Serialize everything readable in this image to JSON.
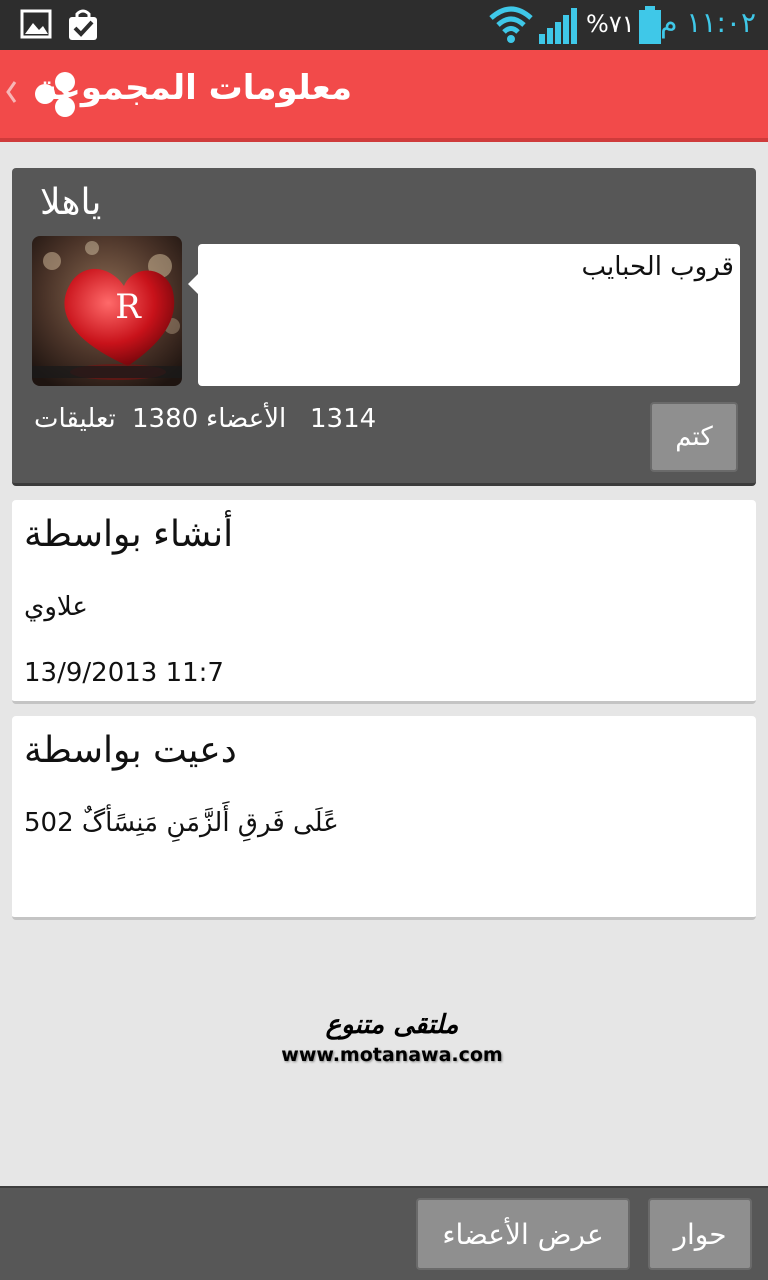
{
  "status_bar": {
    "time": "١١:٠٢ م",
    "battery_percent": "%٧١",
    "icons": [
      "image-icon",
      "bag-check-icon",
      "wifi-icon",
      "signal-icon",
      "battery-icon"
    ]
  },
  "header": {
    "title": "معلومات المجموعة",
    "accent_color": "#f24a4a"
  },
  "group": {
    "name": "ياهلا",
    "avatar_letter": "R",
    "description": "قروب الحبايب",
    "members_count": "1314",
    "members_label": "الأعضاء",
    "comments_count": "1380",
    "comments_label": "تعليقات",
    "mute_label": "كتم"
  },
  "created": {
    "heading": "أنشاء بواسطة",
    "by": "علاوي",
    "datetime": "13/9/2013 11:7"
  },
  "invited": {
    "heading": "دعيت بواسطة",
    "by": "عًلَى فَرقِ أَلزَّمَنِ مَنِسًأگٌ 502"
  },
  "watermark": {
    "arabic": "ملتقى متنوع",
    "url": "www.motanawa.com"
  },
  "bottom_bar": {
    "show_members_label": "عرض الأعضاء",
    "chat_label": "حوار"
  }
}
